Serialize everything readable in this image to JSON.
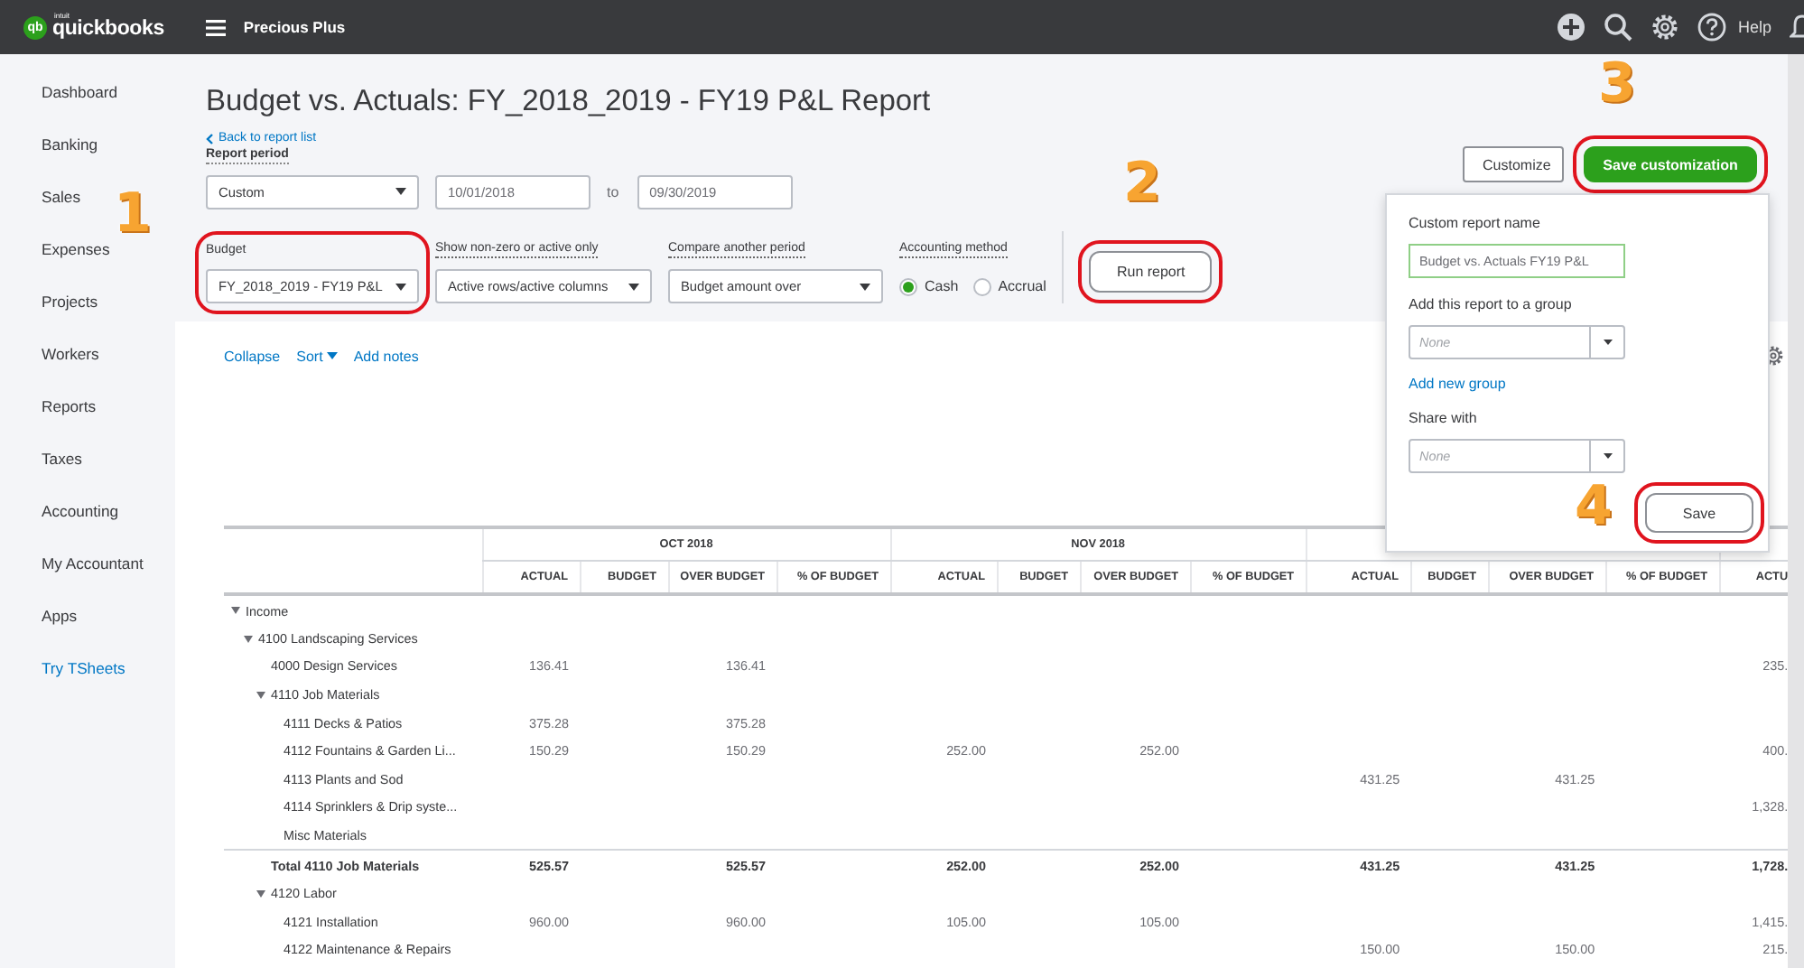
{
  "top_bar": {
    "logo_mark": "qb",
    "logo_brand": "intuit",
    "logo_name": "quickbooks",
    "company": "Precious Plus",
    "help_label": "Help"
  },
  "sidebar": {
    "items": [
      {
        "label": "Dashboard",
        "kind": "nav"
      },
      {
        "label": "Banking",
        "kind": "nav"
      },
      {
        "label": "Sales",
        "kind": "nav"
      },
      {
        "label": "Expenses",
        "kind": "nav"
      },
      {
        "label": "Projects",
        "kind": "nav"
      },
      {
        "label": "Workers",
        "kind": "nav"
      },
      {
        "label": "Reports",
        "kind": "nav"
      },
      {
        "label": "Taxes",
        "kind": "nav"
      },
      {
        "label": "Accounting",
        "kind": "nav"
      },
      {
        "label": "My Accountant",
        "kind": "nav"
      },
      {
        "label": "Apps",
        "kind": "nav"
      },
      {
        "label": "Try TSheets",
        "kind": "promo"
      }
    ]
  },
  "header": {
    "title": "Budget vs. Actuals: FY_2018_2019 - FY19 P&L Report",
    "back_link": "Back to report list",
    "report_period_label": "Report period",
    "period": "Custom",
    "from_date": "10/01/2018",
    "to_label": "to",
    "to_date": "09/30/2019",
    "filters": [
      {
        "label": "Budget",
        "kind": "select",
        "value": "FY_2018_2019 - FY19 P&L",
        "highlighted": true
      },
      {
        "label": "Show non-zero or active only",
        "kind": "select",
        "value": "Active rows/active columns"
      },
      {
        "label": "Compare another period",
        "kind": "select",
        "value": "Budget amount over"
      },
      {
        "label": "Accounting method",
        "kind": "radio",
        "options": [
          {
            "label": "Cash",
            "selected": true
          },
          {
            "label": "Accrual",
            "selected": false
          }
        ]
      }
    ],
    "run_button": {
      "label": "Run report",
      "highlighted": true
    },
    "customize_button": {
      "label": "Customize"
    },
    "save_customization_button": {
      "label": "Save customization",
      "highlighted": true
    }
  },
  "save_popup": {
    "name_label": "Custom report name",
    "name_value": "Budget vs. Actuals FY19 P&L",
    "group_label": "Add this report to a group",
    "group_placeholder": "None",
    "add_group_link": "Add new group",
    "share_label": "Share with",
    "share_placeholder": "None",
    "save_button": {
      "label": "Save",
      "highlighted": true
    }
  },
  "report": {
    "toolbar": [
      {
        "label": "Collapse",
        "kind": "link"
      },
      {
        "label": "Sort",
        "kind": "menu"
      },
      {
        "label": "Add notes",
        "kind": "link"
      }
    ],
    "months": [
      {
        "title": "OCT 2018",
        "columns": [
          "ACTUAL",
          "BUDGET",
          "OVER BUDGET",
          "% OF BUDGET"
        ]
      },
      {
        "title": "NOV 2018",
        "columns": [
          "ACTUAL",
          "BUDGET",
          "OVER BUDGET",
          "% OF BUDGET"
        ]
      },
      {
        "columns": [
          "ACTUAL",
          "BUDGET",
          "OVER BUDGET",
          "% OF BUDGET"
        ]
      },
      {
        "columns": [
          "ACTU"
        ]
      }
    ],
    "rows": [
      {
        "label": "Income",
        "kind": "group",
        "expanded": true,
        "children": [
          {
            "label": "4100 Landscaping Services",
            "kind": "group",
            "expanded": true,
            "children": [
              {
                "label": "4000 Design Services",
                "kind": "item",
                "oct_2018": {
                  "actual": "136.41",
                  "over_budget": "136.41"
                },
                "month_4": {
                  "actual": "235."
                }
              },
              {
                "label": "4110 Job Materials",
                "kind": "group",
                "expanded": true,
                "children": [
                  {
                    "label": "4111 Decks & Patios",
                    "kind": "item",
                    "oct_2018": {
                      "actual": "375.28",
                      "over_budget": "375.28"
                    }
                  },
                  {
                    "label": "4112 Fountains & Garden Li...",
                    "kind": "item",
                    "oct_2018": {
                      "actual": "150.29",
                      "over_budget": "150.29"
                    },
                    "nov_2018": {
                      "actual": "252.00",
                      "over_budget": "252.00"
                    },
                    "month_4": {
                      "actual": "400."
                    }
                  },
                  {
                    "label": "4113 Plants and Sod",
                    "kind": "item",
                    "month_3": {
                      "actual": "431.25",
                      "over_budget": "431.25"
                    }
                  },
                  {
                    "label": "4114 Sprinklers & Drip syste...",
                    "kind": "item",
                    "month_4": {
                      "actual": "1,328."
                    }
                  },
                  {
                    "label": "Misc Materials",
                    "kind": "item"
                  },
                  {
                    "label": "Total 4110 Job Materials",
                    "kind": "total",
                    "oct_2018": {
                      "actual": "525.57",
                      "over_budget": "525.57"
                    },
                    "nov_2018": {
                      "actual": "252.00",
                      "over_budget": "252.00"
                    },
                    "month_3": {
                      "actual": "431.25",
                      "over_budget": "431.25"
                    },
                    "month_4": {
                      "actual": "1,728."
                    }
                  }
                ]
              },
              {
                "label": "4120 Labor",
                "kind": "group",
                "expanded": true,
                "children": [
                  {
                    "label": "4121 Installation",
                    "kind": "item",
                    "oct_2018": {
                      "actual": "960.00",
                      "over_budget": "960.00"
                    },
                    "nov_2018": {
                      "actual": "105.00",
                      "over_budget": "105.00"
                    },
                    "month_4": {
                      "actual": "1,415."
                    }
                  },
                  {
                    "label": "4122 Maintenance & Repairs",
                    "kind": "item",
                    "month_3": {
                      "actual": "150.00",
                      "over_budget": "150.00"
                    },
                    "month_4": {
                      "actual": "215."
                    }
                  }
                ]
              }
            ]
          }
        ]
      }
    ]
  },
  "callouts": [
    {
      "label": "1"
    },
    {
      "label": "2"
    },
    {
      "label": "3"
    },
    {
      "label": "4"
    }
  ]
}
